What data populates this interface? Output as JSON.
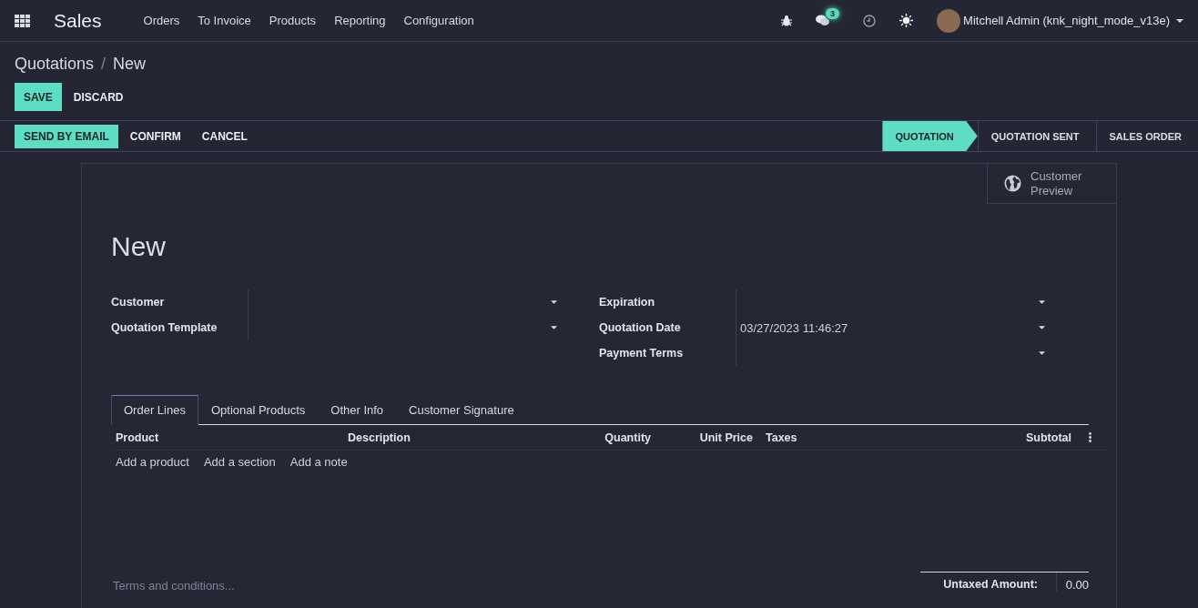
{
  "navbar": {
    "app": "Sales",
    "menu": [
      "Orders",
      "To Invoice",
      "Products",
      "Reporting",
      "Configuration"
    ],
    "chat_count": "3",
    "user": "Mitchell Admin (knk_night_mode_v13e)"
  },
  "breadcrumb": [
    "Quotations",
    "New"
  ],
  "breadcrumb_separator": "/",
  "form_buttons": [
    {
      "label": "SAVE",
      "kind": "primary"
    },
    {
      "label": "DISCARD",
      "kind": "secondary"
    }
  ],
  "action_buttons": [
    {
      "label": "SEND BY EMAIL",
      "kind": "primary"
    },
    {
      "label": "CONFIRM",
      "kind": "secondary"
    },
    {
      "label": "CANCEL",
      "kind": "secondary"
    }
  ],
  "stages": [
    {
      "label": "QUOTATION",
      "selected": true
    },
    {
      "label": "QUOTATION SENT",
      "selected": false
    },
    {
      "label": "SALES ORDER",
      "selected": false
    }
  ],
  "smart_button": {
    "label": "Customer Preview"
  },
  "title": "New",
  "left_fields": [
    {
      "label": "Customer"
    },
    {
      "label": "Quotation Template"
    }
  ],
  "right_fields": [
    {
      "label": "Expiration"
    },
    {
      "label": "Quotation Date",
      "value": "03/27/2023 11:46:27"
    },
    {
      "label": "Payment Terms"
    }
  ],
  "tabs": [
    {
      "label": "Order Lines",
      "selected": true
    },
    {
      "label": "Optional Products",
      "selected": false
    },
    {
      "label": "Other Info",
      "selected": false
    },
    {
      "label": "Customer Signature",
      "selected": false
    }
  ],
  "table": {
    "columns": [
      "Product",
      "Description",
      "Quantity",
      "Unit Price",
      "Taxes",
      "Subtotal"
    ],
    "actions": [
      "Add a product",
      "Add a section",
      "Add a note"
    ]
  },
  "notes": {
    "placeholder": "Terms and conditions..."
  },
  "totals": [
    {
      "label": "Untaxed Amount:",
      "value": "0.00"
    }
  ]
}
